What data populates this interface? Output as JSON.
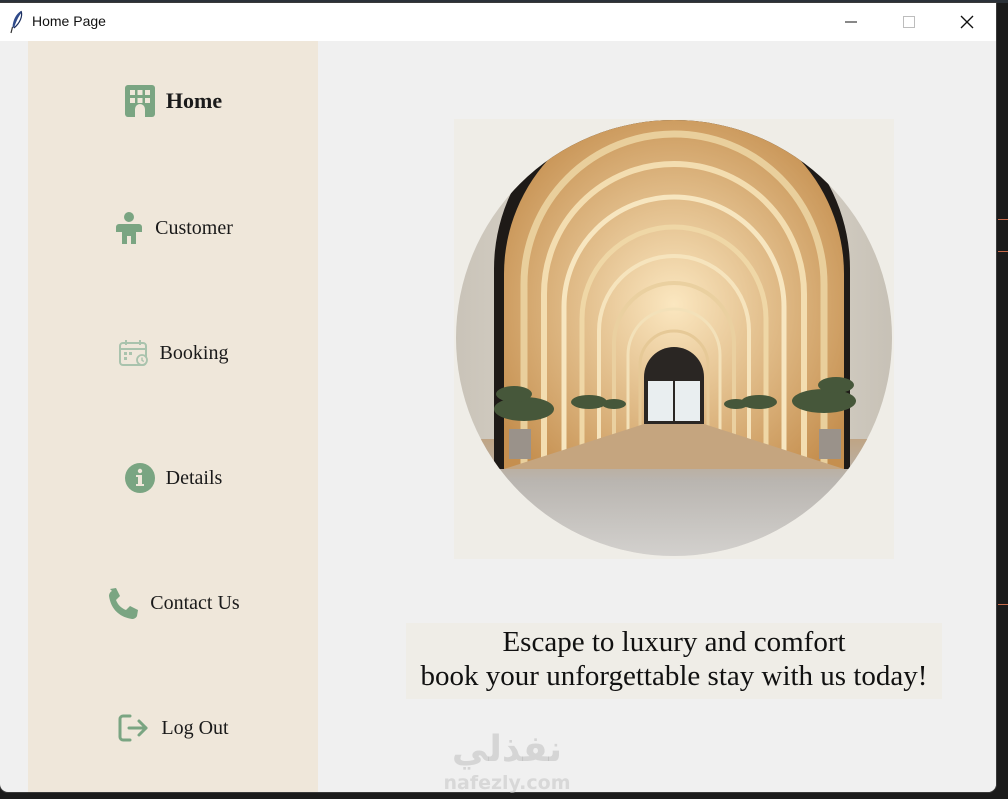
{
  "window": {
    "title": "Home Page",
    "controls": {
      "minimize": "minimize",
      "maximize": "maximize",
      "close": "close"
    }
  },
  "sidebar": {
    "items": [
      {
        "label": "Home",
        "icon": "building-icon",
        "active": true
      },
      {
        "label": "Customer",
        "icon": "person-icon",
        "active": false
      },
      {
        "label": "Booking",
        "icon": "calendar-icon",
        "active": false
      },
      {
        "label": "Details",
        "icon": "info-icon",
        "active": false
      },
      {
        "label": "Contact Us",
        "icon": "phone-icon",
        "active": false
      },
      {
        "label": "Log Out",
        "icon": "logout-icon",
        "active": false
      }
    ]
  },
  "main": {
    "tagline_line1": "Escape to luxury and comfort",
    "tagline_line2": "book your unforgettable stay with us today!"
  },
  "watermark": {
    "arabic": "نفذلي",
    "latin": "nafezly.com"
  },
  "colors": {
    "sidebar_bg": "#efe7da",
    "icon_green": "#7aa582",
    "content_bg": "#f0f0f0"
  }
}
